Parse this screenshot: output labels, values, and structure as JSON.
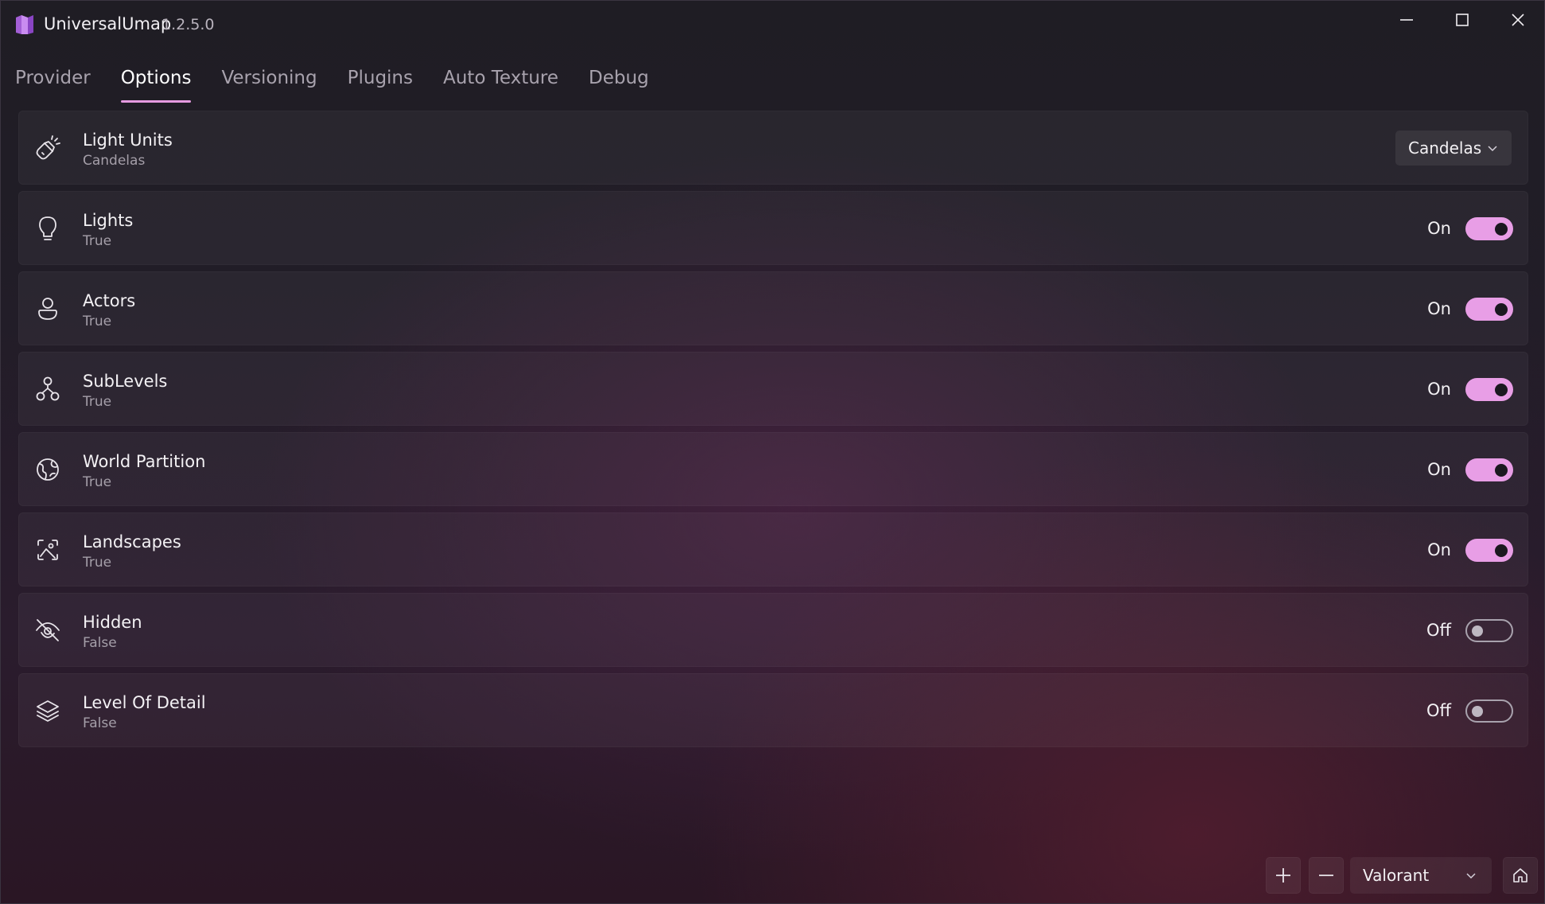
{
  "window": {
    "title": "UniversalUmap",
    "version": "1.2.5.0"
  },
  "tabs": [
    {
      "label": "Provider",
      "active": false
    },
    {
      "label": "Options",
      "active": true
    },
    {
      "label": "Versioning",
      "active": false
    },
    {
      "label": "Plugins",
      "active": false
    },
    {
      "label": "Auto Texture",
      "active": false
    },
    {
      "label": "Debug",
      "active": false
    }
  ],
  "settings": {
    "light_units": {
      "title": "Light Units",
      "value": "Candelas",
      "selected": "Candelas",
      "icon": "flashlight-icon"
    },
    "lights": {
      "title": "Lights",
      "value": "True",
      "state": "On",
      "icon": "lightbulb-icon"
    },
    "actors": {
      "title": "Actors",
      "value": "True",
      "state": "On",
      "icon": "person-icon"
    },
    "sublevels": {
      "title": "SubLevels",
      "value": "True",
      "state": "On",
      "icon": "hierarchy-icon"
    },
    "world_partition": {
      "title": "World Partition",
      "value": "True",
      "state": "On",
      "icon": "globe-icon"
    },
    "landscapes": {
      "title": "Landscapes",
      "value": "True",
      "state": "On",
      "icon": "landscape-image-icon"
    },
    "hidden": {
      "title": "Hidden",
      "value": "False",
      "state": "Off",
      "icon": "eye-off-icon"
    },
    "level_of_detail": {
      "title": "Level Of Detail",
      "value": "False",
      "state": "Off",
      "icon": "layers-icon"
    }
  },
  "bottom": {
    "game": "Valorant"
  },
  "colors": {
    "accent": "#e89ee6",
    "tab_underline": "#e59ae0"
  }
}
